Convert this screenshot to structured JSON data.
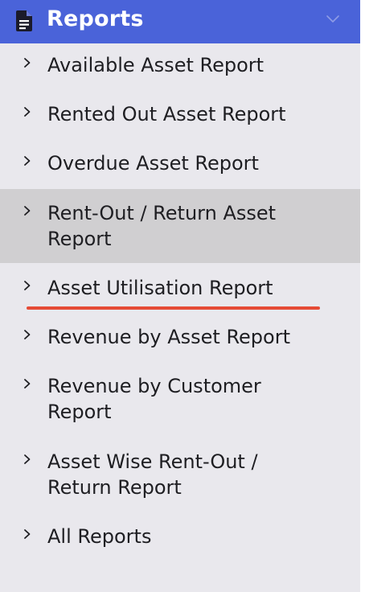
{
  "header": {
    "title": "Reports",
    "icon": "document-icon",
    "collapse_icon": "chevron-down-icon",
    "background": "#4a63d9"
  },
  "menu": {
    "items": [
      {
        "label": "Available Asset Report"
      },
      {
        "label": "Rented Out Asset Report"
      },
      {
        "label": "Overdue Asset Report"
      },
      {
        "label": "Rent-Out / Return Asset Report",
        "active": true
      },
      {
        "label": "Asset Utilisation Report",
        "annotated": true
      },
      {
        "label": "Revenue by Asset Report"
      },
      {
        "label": "Revenue by Customer Report"
      },
      {
        "label": "Asset Wise Rent-Out / Return Report"
      },
      {
        "label": "All Reports"
      }
    ]
  },
  "annotation": {
    "color": "#e54b36"
  }
}
